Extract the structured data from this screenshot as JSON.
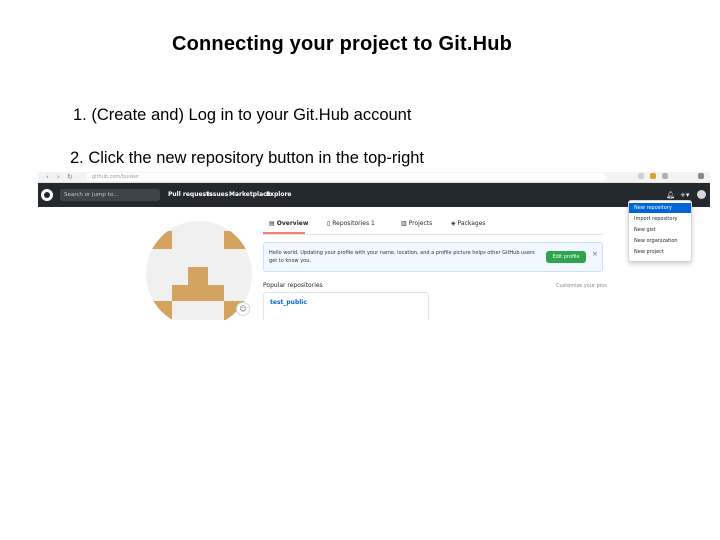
{
  "slide": {
    "title": "Connecting your project to Git.Hub",
    "steps": [
      "1. (Create and) Log in to your Git.Hub account",
      "2. Click the new repository button in the top-right"
    ]
  },
  "browser": {
    "nav_icons": [
      "back-icon",
      "forward-icon",
      "reload-icon"
    ],
    "url": "github.com/buoker"
  },
  "github": {
    "search_placeholder": "Search or jump to...",
    "nav": [
      "Pull requests",
      "Issues",
      "Marketplace",
      "Explore"
    ],
    "header_icons": [
      "bell-icon",
      "plus-icon",
      "avatar"
    ],
    "dropdown": [
      "New repository",
      "Import repository",
      "New gist",
      "New organization",
      "New project"
    ],
    "tabs": [
      {
        "label": "Overview",
        "icon": "book-icon"
      },
      {
        "label": "Repositories",
        "icon": "repo-icon",
        "count": "1"
      },
      {
        "label": "Projects",
        "icon": "project-icon"
      },
      {
        "label": "Packages",
        "icon": "package-icon"
      }
    ],
    "banner": {
      "text": "Hello world. Updating your profile with your name, location, and a profile picture helps other GitHub users get to know you.",
      "button": "Edit profile",
      "close": "×"
    },
    "popular_heading": "Popular repositories",
    "customize_link": "Customize your pins",
    "repo_name": "test_public",
    "status_emoji": "☺"
  },
  "colors": {
    "header": "#24292e",
    "accent": "#0366d6",
    "success": "#2ea44f",
    "identicon": "#d3a35f"
  }
}
